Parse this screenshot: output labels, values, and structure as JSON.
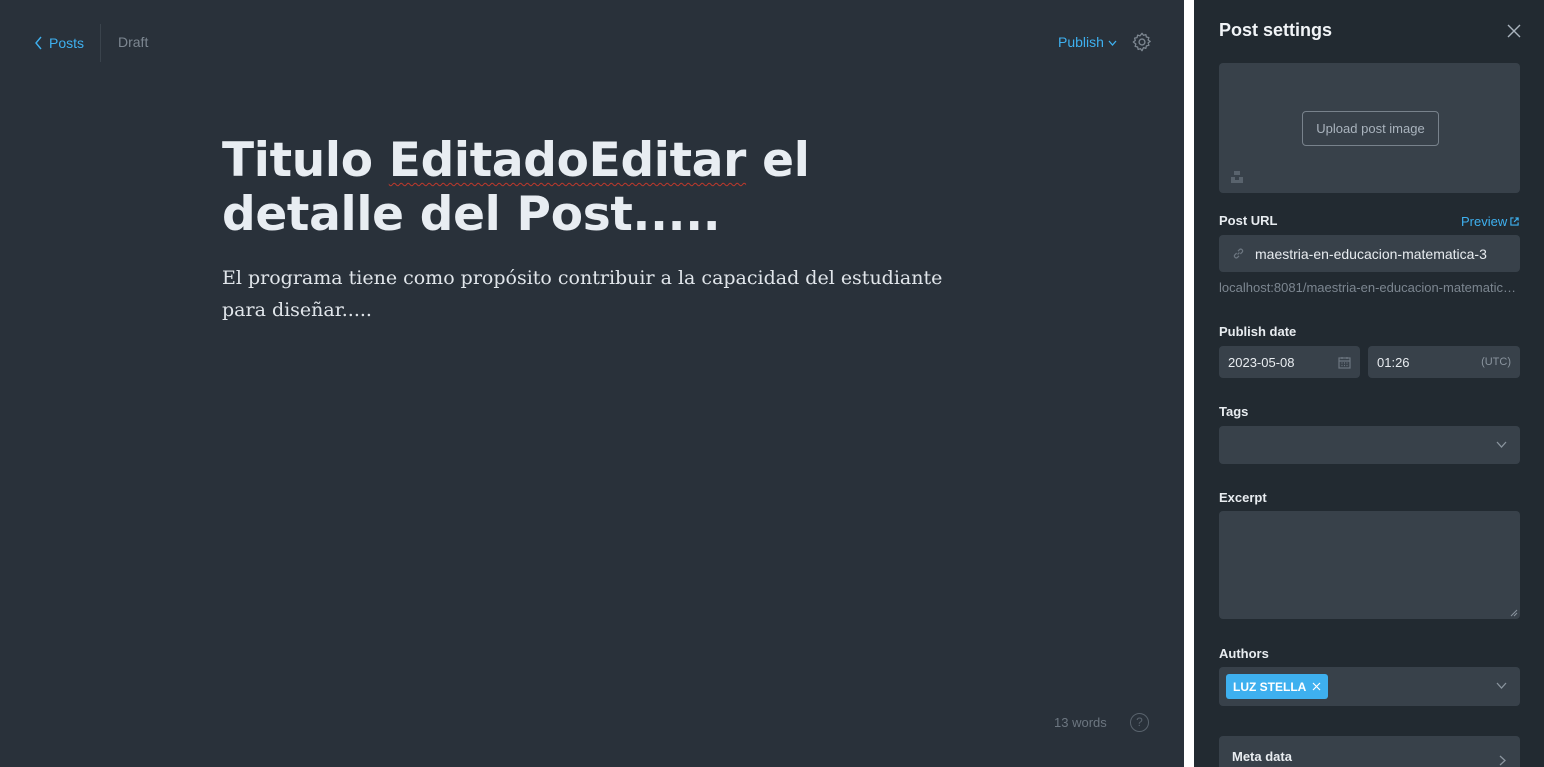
{
  "editor": {
    "back_label": "Posts",
    "status": "Draft",
    "publish_label": "Publish",
    "title_word1": "Titulo ",
    "title_misspelled": "EditadoEditar",
    "title_rest": " el detalle del Post.....",
    "body": "El programa tiene como propósito contribuir a la capacidad del estudiante para diseñar.....",
    "word_count": "13 words",
    "help_label": "?"
  },
  "settings": {
    "title": "Post settings",
    "upload_label": "Upload post image",
    "post_url_label": "Post URL",
    "preview_label": "Preview",
    "slug": "maestria-en-educacion-matematica-3",
    "url_hint": "localhost:8081/maestria-en-educacion-matematica-3/",
    "publish_date_label": "Publish date",
    "date": "2023-05-08",
    "time": "01:26",
    "timezone": "(UTC)",
    "tags_label": "Tags",
    "excerpt_label": "Excerpt",
    "authors_label": "Authors",
    "author_name": "LUZ STELLA",
    "meta_data_label": "Meta data"
  },
  "colors": {
    "accent": "#3eb0ef",
    "editor_bg": "#29313a",
    "panel_bg": "#222a31",
    "field_bg": "#38414a"
  }
}
